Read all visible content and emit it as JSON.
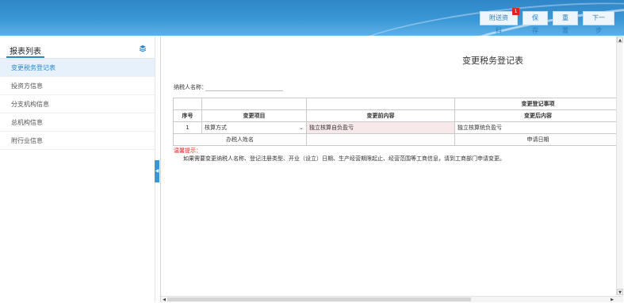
{
  "header": {
    "buttons": {
      "attach": "附送资料",
      "attach_badge": "1",
      "save": "保存",
      "reset": "重置",
      "next": "下一步"
    }
  },
  "sidebar": {
    "title": "报表列表",
    "items": [
      {
        "label": "变更税务登记表",
        "active": true
      },
      {
        "label": "投资方信息",
        "active": false
      },
      {
        "label": "分支机构信息",
        "active": false
      },
      {
        "label": "总机构信息",
        "active": false
      },
      {
        "label": "附行业信息",
        "active": false
      }
    ]
  },
  "form": {
    "title": "变更税务登记表",
    "taxpayer_label": "纳税人名称：",
    "table": {
      "group_header": "变更登记事项",
      "headers": [
        "序号",
        "变更项目",
        "变更前内容",
        "变更后内容"
      ],
      "rows": [
        {
          "no": "1",
          "item": "核算方式",
          "before": "独立核算自负盈亏",
          "after": "独立核算统负盈亏"
        }
      ],
      "footer": {
        "agent_label": "办税人姓名",
        "date_label": "申请日期"
      }
    },
    "warning_title": "温馨提示：",
    "warning_text": "如果需要变更纳税人名称、登记注册类型、开业（设立）日期、生产经营期限起止、经营范围等工商信息，请到工商部门申请变更。"
  },
  "colors": {
    "header_blue": "#2f86c7",
    "active_item_bg": "#e6f1fb",
    "warning_red": "#dd2222",
    "badge_red": "#e02222"
  }
}
